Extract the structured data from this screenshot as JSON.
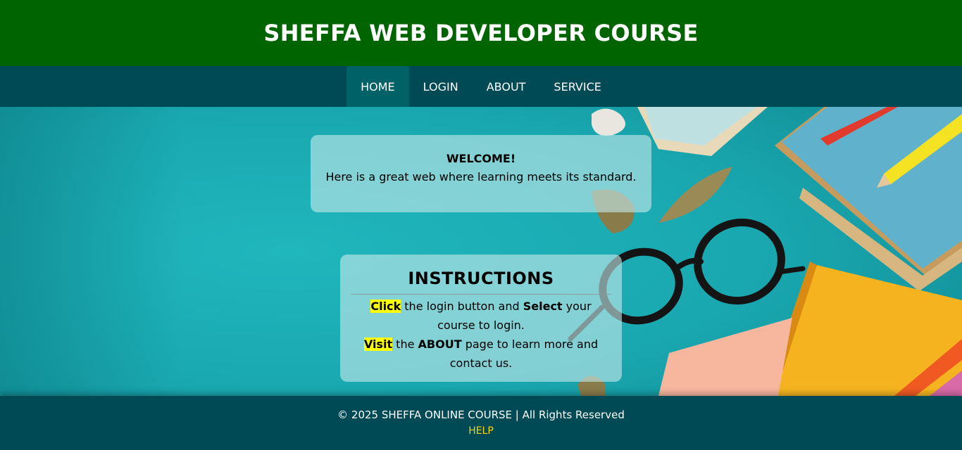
{
  "header": {
    "title": "SHEFFA WEB DEVELOPER COURSE"
  },
  "nav": {
    "items": [
      {
        "label": "HOME",
        "active": true
      },
      {
        "label": "LOGIN"
      },
      {
        "label": "ABOUT"
      },
      {
        "label": "SERVICE"
      }
    ]
  },
  "welcome": {
    "title": "WELCOME!",
    "text": "Here is a great web where learning meets its standard."
  },
  "instructions": {
    "title": "INSTRUCTIONS",
    "line1": {
      "highlight": "Click",
      "text_a": " the login button and ",
      "bold": "Select",
      "text_b": " your course to login."
    },
    "line2": {
      "highlight": "Visit",
      "text_a": " the ",
      "bold": "ABOUT",
      "text_b": " page to learn more and contact us."
    }
  },
  "footer": {
    "copyright": "© 2025 SHEFFA ONLINE COURSE | All Rights Reserved",
    "help": "HELP"
  },
  "colors": {
    "header_bg": "#006400",
    "nav_bg": "#004a55",
    "nav_active_bg": "#006266",
    "highlight": "#ffff00",
    "help_link": "#ffd700"
  }
}
